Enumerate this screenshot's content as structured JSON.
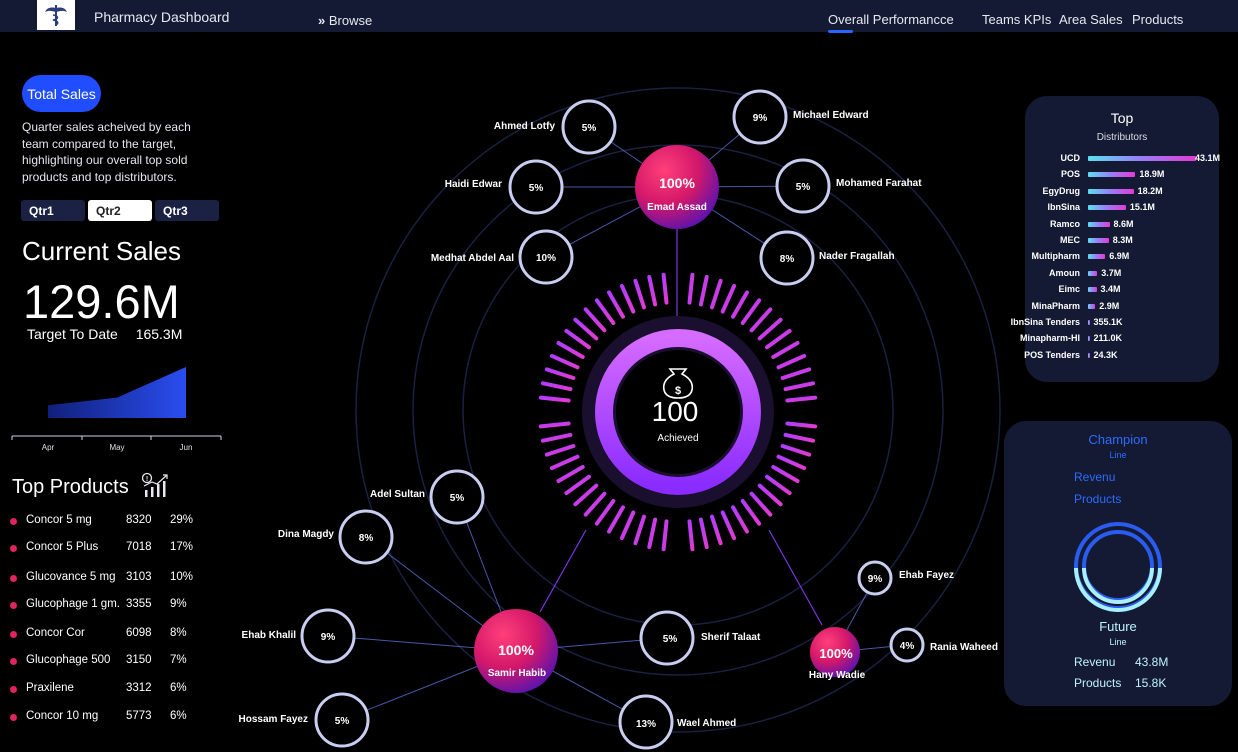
{
  "app": {
    "title": "Pharmacy Dashboard",
    "browse": "Browse",
    "nav": [
      "Overall Performancce",
      "Teams KPIs",
      "Area Sales",
      "Products"
    ]
  },
  "total_sales": {
    "pill": "Total Sales",
    "description": "Quarter sales  acheived by each team compared to the target, highlighting our overall top sold products and top distributors.",
    "quarters": [
      "Qtr1",
      "Qtr2",
      "Qtr3"
    ],
    "active_quarter": "Qtr2",
    "current_label": "Current Sales",
    "current_value": "129.6M",
    "target_label": "Target To Date",
    "target_value": "165.3M"
  },
  "trend": {
    "months": [
      "Apr",
      "May",
      "Jun"
    ],
    "relative_values": [
      0.25,
      0.4,
      1.0
    ]
  },
  "top_products": {
    "title": "Top Products",
    "items": [
      {
        "name": "Concor 5 mg",
        "qty": "8320",
        "pct": "29%"
      },
      {
        "name": "Concor 5 Plus",
        "qty": "7018",
        "pct": "17%"
      },
      {
        "name": "Glucovance 5 mg",
        "qty": "3103",
        "pct": "10%"
      },
      {
        "name": "Glucophage 1 gm.",
        "qty": "3355",
        "pct": "9%"
      },
      {
        "name": "Concor Cor",
        "qty": "6098",
        "pct": "8%"
      },
      {
        "name": "Glucophage 500",
        "qty": "3150",
        "pct": "7%"
      },
      {
        "name": "Praxilene",
        "qty": "3312",
        "pct": "6%"
      },
      {
        "name": "Concor 10 mg",
        "qty": "5773",
        "pct": "6%"
      }
    ]
  },
  "center": {
    "value": "100",
    "label": "Achieved"
  },
  "teams": [
    {
      "leader": "Emad Assad",
      "leader_pct": "100%",
      "members": [
        {
          "name": "Ahmed Lotfy",
          "pct": "5%"
        },
        {
          "name": "Michael Edward",
          "pct": "9%"
        },
        {
          "name": "Haidi Edwar",
          "pct": "5%"
        },
        {
          "name": "Mohamed Farahat",
          "pct": "5%"
        },
        {
          "name": "Medhat Abdel Aal",
          "pct": "10%"
        },
        {
          "name": "Nader Fragallah",
          "pct": "8%"
        }
      ]
    },
    {
      "leader": "Samir Habib",
      "leader_pct": "100%",
      "members": [
        {
          "name": "Adel Sultan",
          "pct": "5%"
        },
        {
          "name": "Dina Magdy",
          "pct": "8%"
        },
        {
          "name": "Ehab Khalil",
          "pct": "9%"
        },
        {
          "name": "Sherif Talaat",
          "pct": "5%"
        },
        {
          "name": "Hossam Fayez",
          "pct": "5%"
        },
        {
          "name": "Wael Ahmed",
          "pct": "13%"
        }
      ]
    },
    {
      "leader": "Hany Wadie",
      "leader_pct": "100%",
      "members": [
        {
          "name": "Ehab Fayez",
          "pct": "9%"
        },
        {
          "name": "Rania Waheed",
          "pct": "4%"
        }
      ]
    }
  ],
  "distributors": {
    "title": "Top",
    "subtitle": "Distributors",
    "items": [
      {
        "name": "UCD",
        "value": "43.1M",
        "amount": 43.1
      },
      {
        "name": "POS",
        "value": "18.9M",
        "amount": 18.9
      },
      {
        "name": "EgyDrug",
        "value": "18.2M",
        "amount": 18.2
      },
      {
        "name": "IbnSina",
        "value": "15.1M",
        "amount": 15.1
      },
      {
        "name": "Ramco",
        "value": "8.6M",
        "amount": 8.6
      },
      {
        "name": "MEC",
        "value": "8.3M",
        "amount": 8.3
      },
      {
        "name": "Multipharm",
        "value": "6.9M",
        "amount": 6.9
      },
      {
        "name": "Amoun",
        "value": "3.7M",
        "amount": 3.7
      },
      {
        "name": "Eimc",
        "value": "3.4M",
        "amount": 3.4
      },
      {
        "name": "MinaPharm",
        "value": "2.9M",
        "amount": 2.9
      },
      {
        "name": "IbnSina Tenders",
        "value": "355.1K",
        "amount": 0.3551
      },
      {
        "name": "Minapharm-HI",
        "value": "211.0K",
        "amount": 0.211
      },
      {
        "name": "POS Tenders",
        "value": "24.3K",
        "amount": 0.0243
      }
    ]
  },
  "champion": {
    "title": "Champion",
    "subtitle": "Line",
    "revenue_label": "Revenu",
    "products_label": "Products"
  },
  "future": {
    "title": "Future",
    "subtitle": "Line",
    "revenue_label": "Revenu",
    "revenue_value": "43.8M",
    "products_label": "Products",
    "products_value": "15.8K"
  },
  "colors": {
    "accent": "#1f4dff",
    "panel": "#141a33",
    "magenta": "#e0245e",
    "purple": "#b23cff"
  }
}
